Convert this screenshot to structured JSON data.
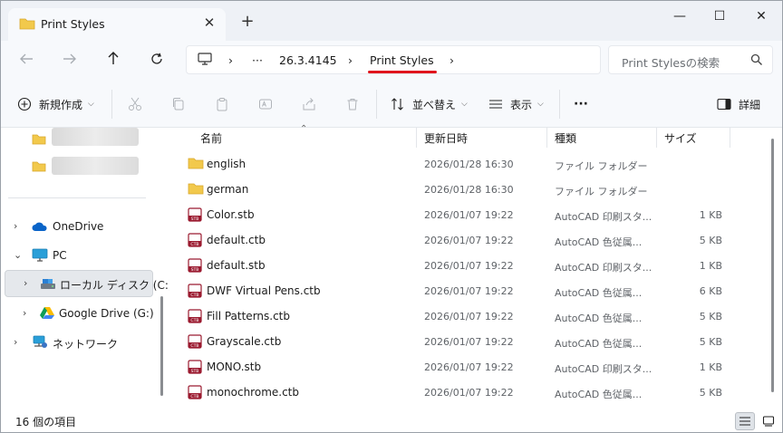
{
  "tab": {
    "title": "Print Styles",
    "close": "✕",
    "new_tab": "+"
  },
  "window_controls": {
    "minimize": "—",
    "maximize": "☐",
    "close": "✕"
  },
  "address": {
    "ellipsis": "···",
    "crumbs": [
      "26.3.4145",
      "Print Styles"
    ],
    "sep": "›"
  },
  "search": {
    "placeholder": "Print Stylesの検索"
  },
  "toolbar": {
    "new_label": "新規作成",
    "sort_label": "並べ替え",
    "view_label": "表示",
    "more_label": "···",
    "details_label": "詳細"
  },
  "nav": {
    "onedrive": "OneDrive",
    "pc": "PC",
    "local_disk": "ローカル ディスク (C:)",
    "google_drive": "Google Drive (G:)",
    "network": "ネットワーク"
  },
  "columns": {
    "name": "名前",
    "date": "更新日時",
    "type": "種類",
    "size": "サイズ"
  },
  "files": [
    {
      "name": "english",
      "date": "2026/01/28 16:30",
      "type": "ファイル フォルダー",
      "size": "",
      "kind": "folder"
    },
    {
      "name": "german",
      "date": "2026/01/28 16:30",
      "type": "ファイル フォルダー",
      "size": "",
      "kind": "folder"
    },
    {
      "name": "Color.stb",
      "date": "2026/01/07 19:22",
      "type": "AutoCAD 印刷スタ...",
      "size": "1 KB",
      "kind": "stb"
    },
    {
      "name": "default.ctb",
      "date": "2026/01/07 19:22",
      "type": "AutoCAD 色従属...",
      "size": "5 KB",
      "kind": "ctb"
    },
    {
      "name": "default.stb",
      "date": "2026/01/07 19:22",
      "type": "AutoCAD 印刷スタ...",
      "size": "1 KB",
      "kind": "stb"
    },
    {
      "name": "DWF Virtual Pens.ctb",
      "date": "2026/01/07 19:22",
      "type": "AutoCAD 色従属...",
      "size": "6 KB",
      "kind": "ctb"
    },
    {
      "name": "Fill Patterns.ctb",
      "date": "2026/01/07 19:22",
      "type": "AutoCAD 色従属...",
      "size": "5 KB",
      "kind": "ctb"
    },
    {
      "name": "Grayscale.ctb",
      "date": "2026/01/07 19:22",
      "type": "AutoCAD 色従属...",
      "size": "5 KB",
      "kind": "ctb"
    },
    {
      "name": "MONO.stb",
      "date": "2026/01/07 19:22",
      "type": "AutoCAD 印刷スタ...",
      "size": "1 KB",
      "kind": "stb"
    },
    {
      "name": "monochrome.ctb",
      "date": "2026/01/07 19:22",
      "type": "AutoCAD 色従属...",
      "size": "5 KB",
      "kind": "ctb"
    }
  ],
  "status": {
    "count": "16 個の項目"
  },
  "colors": {
    "accent_underline": "#e0141c",
    "folder": "#f2c94c",
    "file_icon": "#9b1b30"
  }
}
